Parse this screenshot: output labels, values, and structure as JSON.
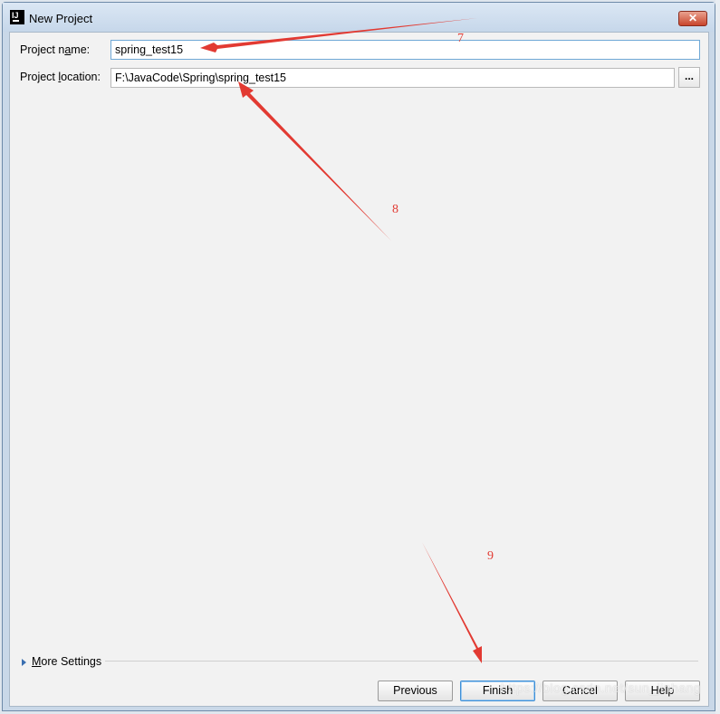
{
  "window": {
    "title": "New Project",
    "app_icon_text": "IJ"
  },
  "form": {
    "project_name_label_pre": "Project n",
    "project_name_label_mnemonic": "a",
    "project_name_label_post": "me:",
    "project_name_value": "spring_test15",
    "project_location_label_pre": "Project ",
    "project_location_label_mnemonic": "l",
    "project_location_label_post": "ocation:",
    "project_location_value": "F:\\JavaCode\\Spring\\spring_test15",
    "browse_label": "..."
  },
  "more_settings": {
    "label_mnemonic": "M",
    "label_rest": "ore Settings"
  },
  "buttons": {
    "previous": "Previous",
    "finish": "Finish",
    "cancel": "Cancel",
    "help": "Help"
  },
  "annotations": {
    "step7": "7",
    "step8": "8",
    "step9": "9",
    "arrow_color": "#e23a32"
  },
  "watermark": "https://blog.csdn.net/sun_jinhang",
  "colors": {
    "accent": "#3f8fd6",
    "annotation": "#e23a32"
  }
}
